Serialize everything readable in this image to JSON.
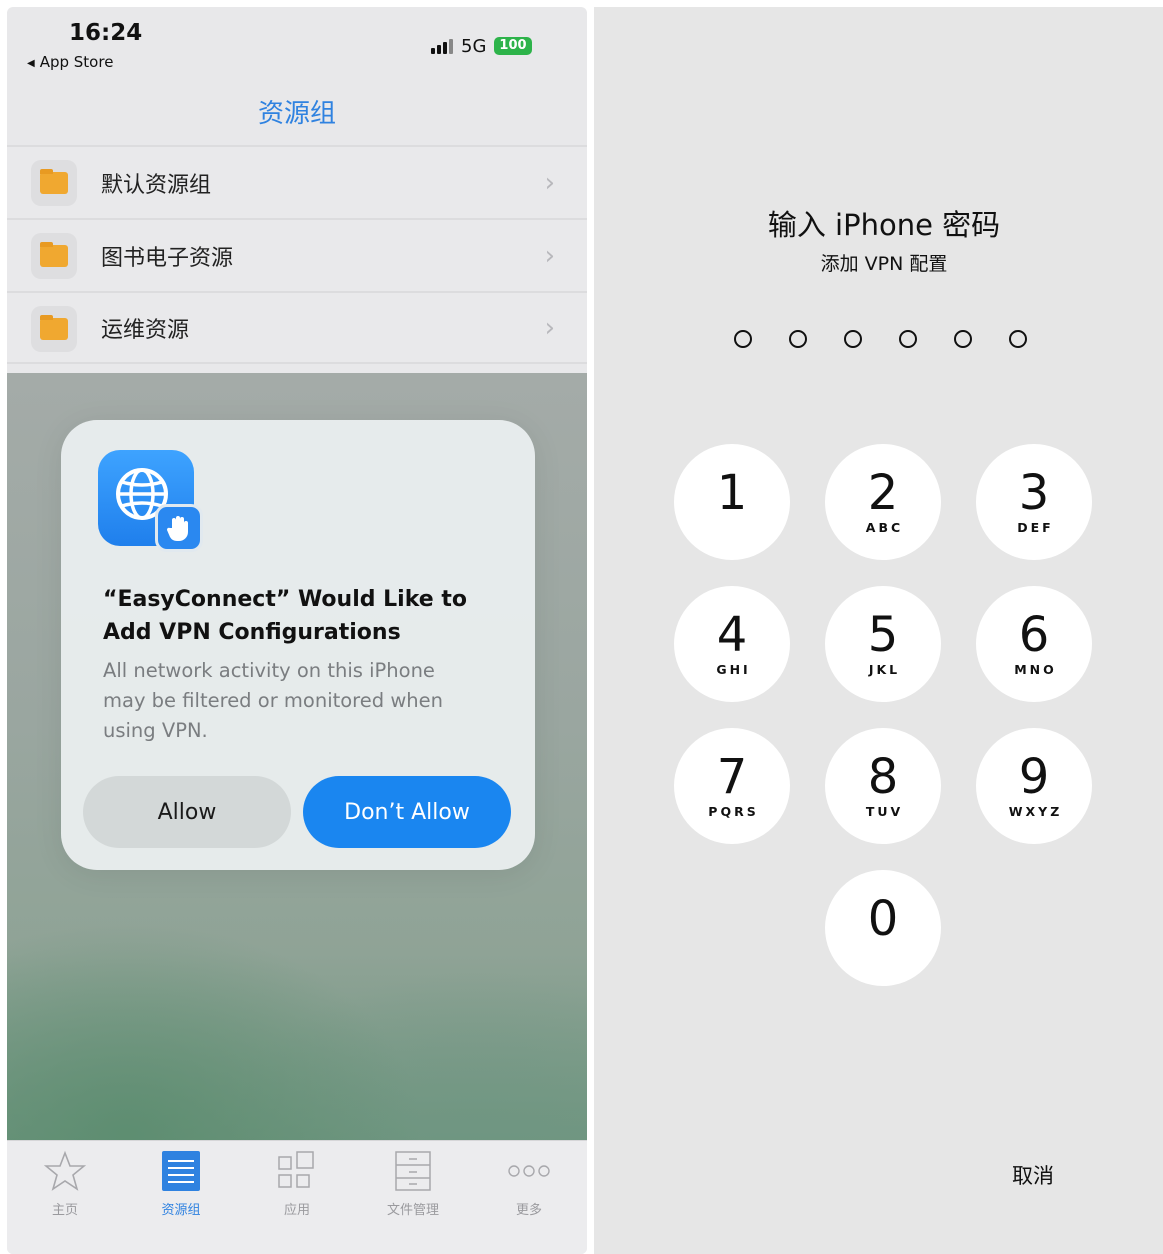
{
  "left": {
    "status_bar": {
      "time": "16:24",
      "back_app": "App Store",
      "network": "5G",
      "battery": "100"
    },
    "nav_title": "资源组",
    "resource_groups": [
      {
        "label": "默认资源组",
        "icon": "folder-icon"
      },
      {
        "label": "图书电子资源",
        "icon": "folder-icon"
      },
      {
        "label": "运维资源",
        "icon": "folder-icon"
      }
    ],
    "dialog": {
      "title": "“EasyConnect” Would Like to Add VPN Configurations",
      "message": "All network activity on this iPhone may be filtered or monitored when using VPN.",
      "allow_label": "Allow",
      "deny_label": "Don’t Allow"
    },
    "tabbar": [
      {
        "label": "主页",
        "icon": "star-icon",
        "active": false
      },
      {
        "label": "资源组",
        "icon": "list-icon",
        "active": true
      },
      {
        "label": "应用",
        "icon": "apps-grid-icon",
        "active": false
      },
      {
        "label": "文件管理",
        "icon": "file-icon",
        "active": false
      },
      {
        "label": "更多",
        "icon": "more-icon",
        "active": false
      }
    ],
    "colors": {
      "accent": "#2f82e0",
      "primary_button": "#1a86f0",
      "folder": "#f0a830"
    }
  },
  "right": {
    "title": "输入 iPhone 密码",
    "subtitle": "添加 VPN 配置",
    "passcode_length": 6,
    "keys": [
      {
        "num": "1",
        "letters": ""
      },
      {
        "num": "2",
        "letters": "ABC"
      },
      {
        "num": "3",
        "letters": "DEF"
      },
      {
        "num": "4",
        "letters": "GHI"
      },
      {
        "num": "5",
        "letters": "JKL"
      },
      {
        "num": "6",
        "letters": "MNO"
      },
      {
        "num": "7",
        "letters": "PQRS"
      },
      {
        "num": "8",
        "letters": "TUV"
      },
      {
        "num": "9",
        "letters": "WXYZ"
      },
      {
        "num": "0",
        "letters": ""
      }
    ],
    "cancel_label": "取消"
  }
}
